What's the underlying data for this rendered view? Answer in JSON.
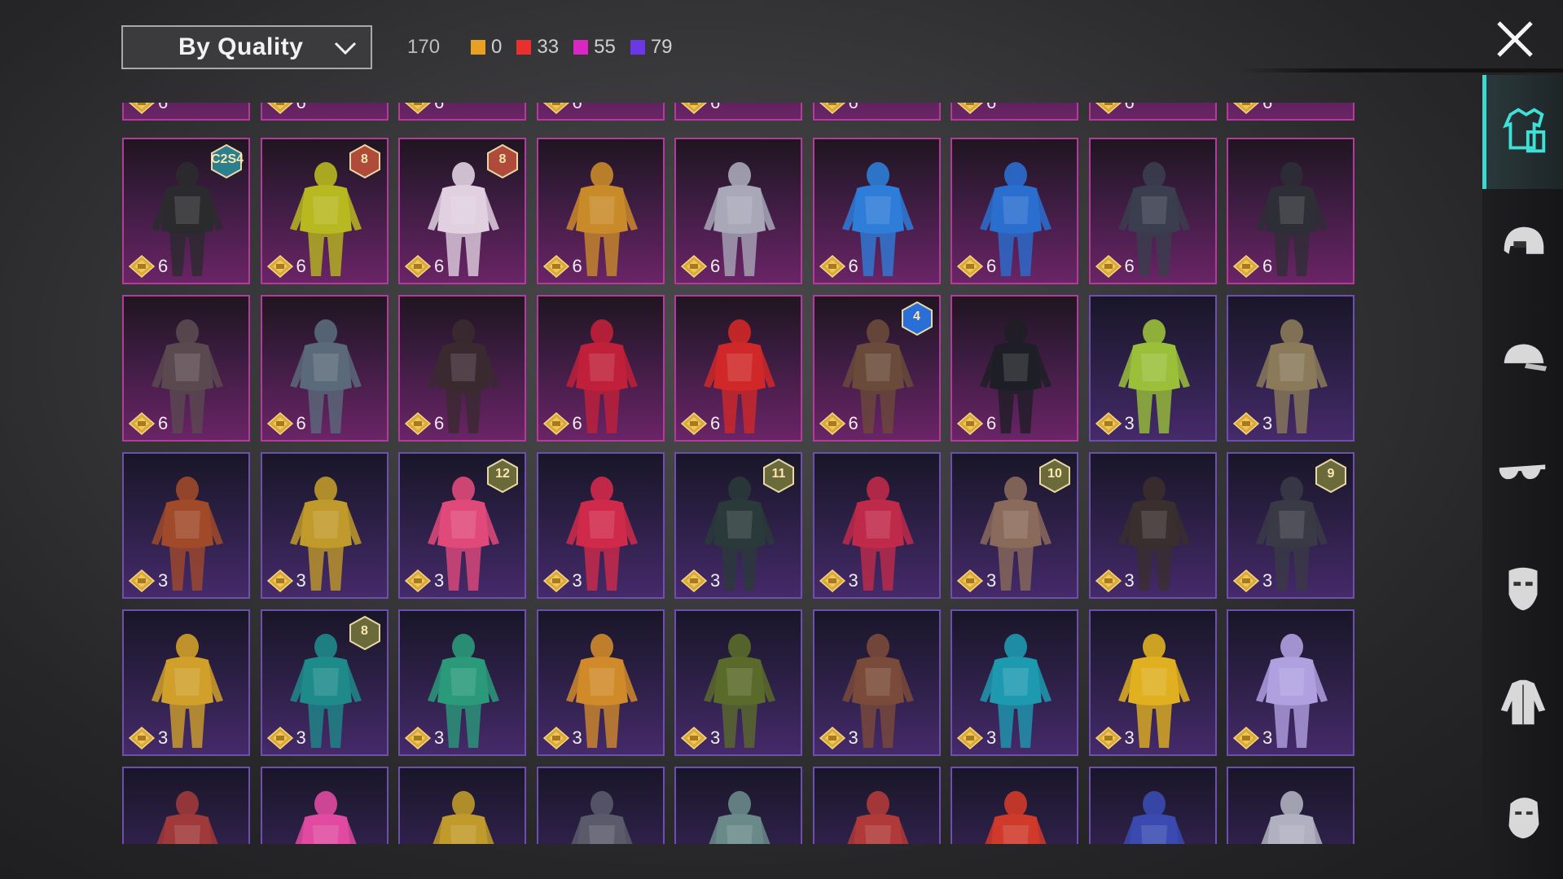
{
  "sort": {
    "label": "By Quality"
  },
  "counts": {
    "total": "170",
    "legend": [
      {
        "color": "#e8a124",
        "value": "0"
      },
      {
        "color": "#e8302f",
        "value": "33"
      },
      {
        "color": "#d927c4",
        "value": "55"
      },
      {
        "color": "#6c38e6",
        "value": "79"
      }
    ]
  },
  "rows": [
    {
      "quality": "red",
      "partial": "top",
      "items": [
        {
          "cost": "6"
        },
        {
          "cost": "6"
        },
        {
          "cost": "6"
        },
        {
          "cost": "6"
        },
        {
          "cost": "6"
        },
        {
          "cost": "6"
        },
        {
          "cost": "6"
        },
        {
          "cost": "6"
        },
        {
          "cost": "6"
        }
      ]
    },
    {
      "quality": "red",
      "items": [
        {
          "cost": "6",
          "badge": "C2S4",
          "badge_color": "#2c7f8c",
          "outfit": "#2b2b2e"
        },
        {
          "cost": "6",
          "badge": "8",
          "badge_color": "#b04a3a",
          "outfit": "#b8b820"
        },
        {
          "cost": "6",
          "badge": "8",
          "badge_color": "#b04a3a",
          "outfit": "#e0d0e0"
        },
        {
          "cost": "6",
          "outfit": "#c98a2a"
        },
        {
          "cost": "6",
          "outfit": "#a8a8b8"
        },
        {
          "cost": "6",
          "outfit": "#2e7dd8"
        },
        {
          "cost": "6",
          "outfit": "#2a6ed0"
        },
        {
          "cost": "6",
          "outfit": "#3a3e4e"
        },
        {
          "cost": "6",
          "outfit": "#2e2e36"
        }
      ]
    },
    {
      "quality": "red",
      "items": [
        {
          "cost": "6",
          "outfit": "#5a4a50"
        },
        {
          "cost": "6",
          "outfit": "#5a6a7a"
        },
        {
          "cost": "6",
          "outfit": "#3a2a30"
        },
        {
          "cost": "6",
          "outfit": "#c0203a"
        },
        {
          "cost": "6",
          "outfit": "#d02828"
        },
        {
          "cost": "6",
          "badge": "4",
          "badge_color": "#2a6fd8",
          "outfit": "#6a4a3a"
        },
        {
          "cost": "6",
          "outfit": "#1e1e26"
        },
        {
          "cost": "3",
          "q": "purple",
          "outfit": "#9ac03a"
        },
        {
          "cost": "3",
          "q": "purple",
          "outfit": "#8a7a5a"
        }
      ]
    },
    {
      "quality": "purple",
      "items": [
        {
          "cost": "3",
          "outfit": "#a04a2a"
        },
        {
          "cost": "3",
          "outfit": "#c09a2a"
        },
        {
          "cost": "3",
          "badge": "12",
          "badge_color": "#6a6a3a",
          "outfit": "#e04a7a"
        },
        {
          "cost": "3",
          "outfit": "#d02a4a"
        },
        {
          "cost": "3",
          "badge": "11",
          "badge_color": "#6a6a3a",
          "outfit": "#2a3a3a"
        },
        {
          "cost": "3",
          "outfit": "#c02a4a"
        },
        {
          "cost": "3",
          "badge": "10",
          "badge_color": "#6a6a3a",
          "outfit": "#8a6a5a"
        },
        {
          "cost": "3",
          "outfit": "#3a2e2e"
        },
        {
          "cost": "3",
          "badge": "9",
          "badge_color": "#6a6a3a",
          "outfit": "#3a3a46"
        }
      ]
    },
    {
      "quality": "purple",
      "items": [
        {
          "cost": "3",
          "outfit": "#d0a02a"
        },
        {
          "cost": "3",
          "badge": "8",
          "badge_color": "#6a6a3a",
          "outfit": "#1e8a8a"
        },
        {
          "cost": "3",
          "outfit": "#2a9a7a"
        },
        {
          "cost": "3",
          "outfit": "#d08a2a"
        },
        {
          "cost": "3",
          "outfit": "#5a6a2a"
        },
        {
          "cost": "3",
          "outfit": "#7a4a3a"
        },
        {
          "cost": "3",
          "outfit": "#1e9ab0"
        },
        {
          "cost": "3",
          "outfit": "#e0b020"
        },
        {
          "cost": "3",
          "outfit": "#b0a0e0"
        }
      ]
    },
    {
      "quality": "purple",
      "partial": "bottom",
      "items": [
        {
          "outfit": "#a03a3a"
        },
        {
          "outfit": "#e04aa0"
        },
        {
          "outfit": "#c09a2a"
        },
        {
          "outfit": "#5a5a6a"
        },
        {
          "outfit": "#6a8a8a"
        },
        {
          "outfit": "#b03a3a"
        },
        {
          "outfit": "#d03a2a"
        },
        {
          "outfit": "#3a4ab0"
        },
        {
          "outfit": "#b0b0c0"
        }
      ]
    }
  ],
  "sidebar": [
    {
      "icon": "outfit-icon",
      "active": true
    },
    {
      "icon": "helmet-icon",
      "active": false
    },
    {
      "icon": "cap-icon",
      "active": false
    },
    {
      "icon": "glasses-icon",
      "active": false
    },
    {
      "icon": "mask-icon",
      "active": false
    },
    {
      "icon": "jacket-icon",
      "active": false
    },
    {
      "icon": "face-icon",
      "active": false
    }
  ]
}
